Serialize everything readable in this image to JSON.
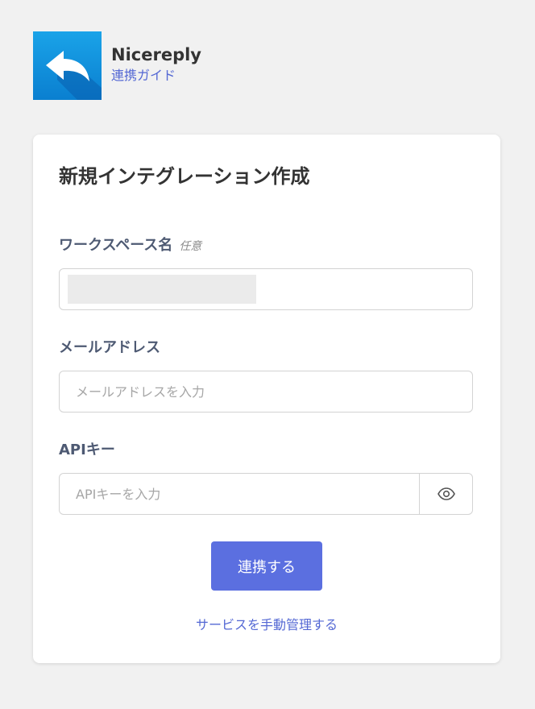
{
  "app": {
    "name": "Nicereply",
    "guide_link": "連携ガイド"
  },
  "form": {
    "title": "新規インテグレーション作成",
    "workspace": {
      "label": "ワークスペース名",
      "optional": "任意",
      "value": ""
    },
    "email": {
      "label": "メールアドレス",
      "placeholder": "メールアドレスを入力"
    },
    "api_key": {
      "label": "APIキー",
      "placeholder": "APIキーを入力"
    },
    "submit_label": "連携する",
    "manual_link": "サービスを手動管理する"
  },
  "icons": {
    "logo": "reply-arrow-icon",
    "reveal": "eye-icon"
  },
  "colors": {
    "accent": "#5b6fe0",
    "link": "#5468d4",
    "logo_blue": "#0a7fd0"
  }
}
